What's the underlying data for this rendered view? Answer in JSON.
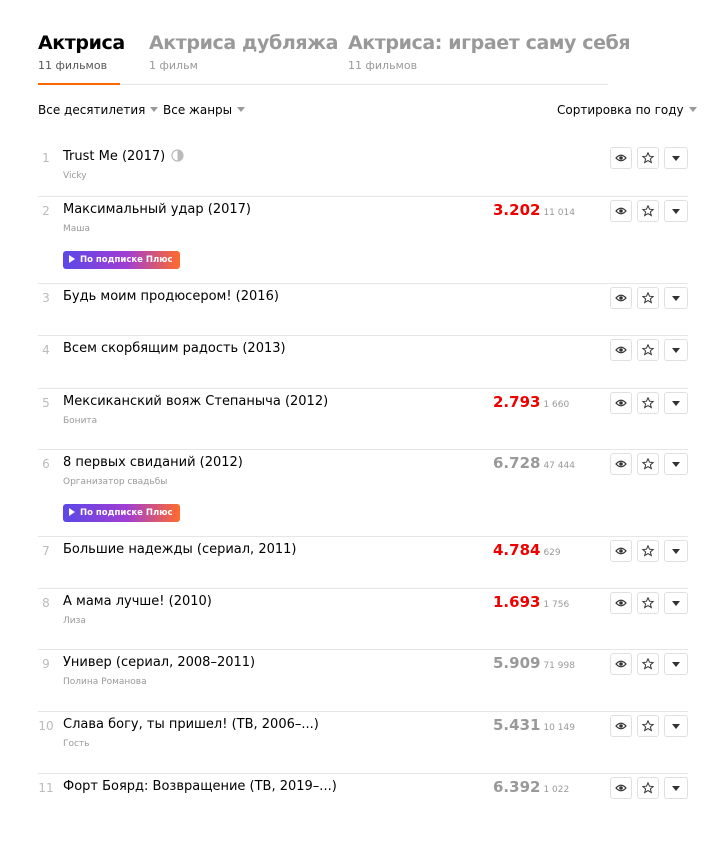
{
  "tabs": [
    {
      "title": "Актриса",
      "count": "11 фильмов",
      "active": true
    },
    {
      "title": "Актриса дубляжа",
      "count": "1 фильм",
      "active": false
    },
    {
      "title": "Актриса: играет саму себя",
      "count": "11 фильмов",
      "active": false
    }
  ],
  "filters": {
    "decades": "Все десятилетия",
    "genres": "Все жанры",
    "sort": "Сортировка по году"
  },
  "badge_label": "По подписке Плюс",
  "colors": {
    "accent": "#ff6600",
    "rating_red": "#ee0000",
    "rating_grey": "#999999"
  },
  "films": [
    {
      "num": "1",
      "title": "Trust Me (2017)",
      "role": "Vicky",
      "rating": "",
      "votes": "",
      "rating_color": "",
      "plus": false,
      "moon_icon": true
    },
    {
      "num": "2",
      "title": "Максимальный удар (2017)",
      "role": "Маша",
      "rating": "3.202",
      "votes": "11 014",
      "rating_color": "red",
      "plus": true
    },
    {
      "num": "3",
      "title": "Будь моим продюсером! (2016)",
      "role": "",
      "rating": "",
      "votes": "",
      "rating_color": "",
      "plus": false
    },
    {
      "num": "4",
      "title": "Всем скорбящим радость (2013)",
      "role": "",
      "rating": "",
      "votes": "",
      "rating_color": "",
      "plus": false
    },
    {
      "num": "5",
      "title": "Мексиканский вояж Степаныча (2012)",
      "role": "Бонита",
      "rating": "2.793",
      "votes": "1 660",
      "rating_color": "red",
      "plus": false
    },
    {
      "num": "6",
      "title": "8 первых свиданий (2012)",
      "role": "Организатор свадьбы",
      "rating": "6.728",
      "votes": "47 444",
      "rating_color": "grey",
      "plus": true
    },
    {
      "num": "7",
      "title": "Большие надежды (сериал, 2011)",
      "role": "",
      "rating": "4.784",
      "votes": "629",
      "rating_color": "red",
      "plus": false
    },
    {
      "num": "8",
      "title": "А мама лучше! (2010)",
      "role": "Лиза",
      "rating": "1.693",
      "votes": "1 756",
      "rating_color": "red",
      "plus": false
    },
    {
      "num": "9",
      "title": "Универ (сериал, 2008–2011)",
      "role": "Полина Романова",
      "rating": "5.909",
      "votes": "71 998",
      "rating_color": "grey",
      "plus": false
    },
    {
      "num": "10",
      "title": "Слава богу, ты пришел! (ТВ, 2006–...)",
      "role": "Гость",
      "rating": "5.431",
      "votes": "10 149",
      "rating_color": "grey",
      "plus": false
    },
    {
      "num": "11",
      "title": "Форт Боярд: Возвращение (ТВ, 2019–...)",
      "role": "",
      "rating": "6.392",
      "votes": "1 022",
      "rating_color": "grey",
      "plus": false
    }
  ]
}
